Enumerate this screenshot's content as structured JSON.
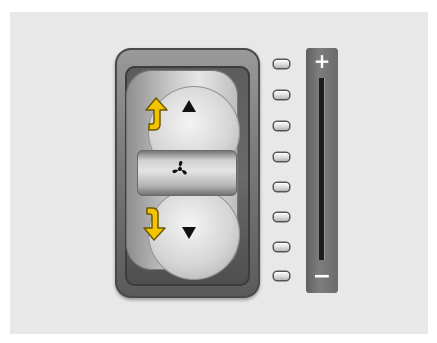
{
  "switch": {
    "up_symbol": "▲",
    "down_symbol": "▼",
    "fan_icon": "fan-icon",
    "arrow_color": "#f5c400"
  },
  "indicators": {
    "count": 8
  },
  "level": {
    "plus_label": "+",
    "minus_label": "−"
  }
}
